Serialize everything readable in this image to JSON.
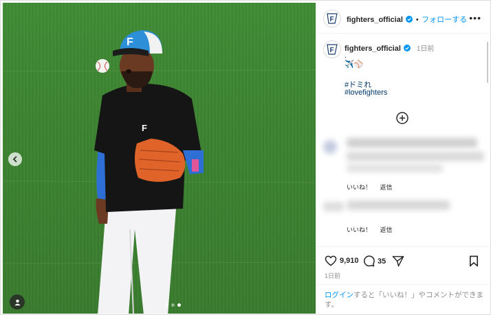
{
  "post": {
    "media": {
      "slide_count": 3,
      "active_slide": 3
    }
  },
  "header": {
    "username": "fighters_official",
    "separator": "•",
    "follow_label": "フォローする",
    "more_label": "•••"
  },
  "caption": {
    "username": "fighters_official",
    "time": "1日前",
    "line1": ".",
    "emoji": "✈️⚾",
    "hashtag1": "#ドミれ",
    "hashtag2": "#lovefighters"
  },
  "comments": [
    {
      "like_label": "いいね！",
      "reply_label": "返信"
    },
    {
      "like_label": "いいね！",
      "reply_label": "返信"
    }
  ],
  "actions": {
    "likes": "9,910",
    "comments": "35",
    "date": "1日前"
  },
  "login_prompt": {
    "link": "ログイン",
    "text": "すると「いいね！」やコメントができます。"
  },
  "colors": {
    "accent": "#0095f6",
    "hashtag": "#00376b",
    "secondary_text": "#8e8e8e",
    "verified": "#0095f6",
    "field_green": "#3b8230"
  }
}
